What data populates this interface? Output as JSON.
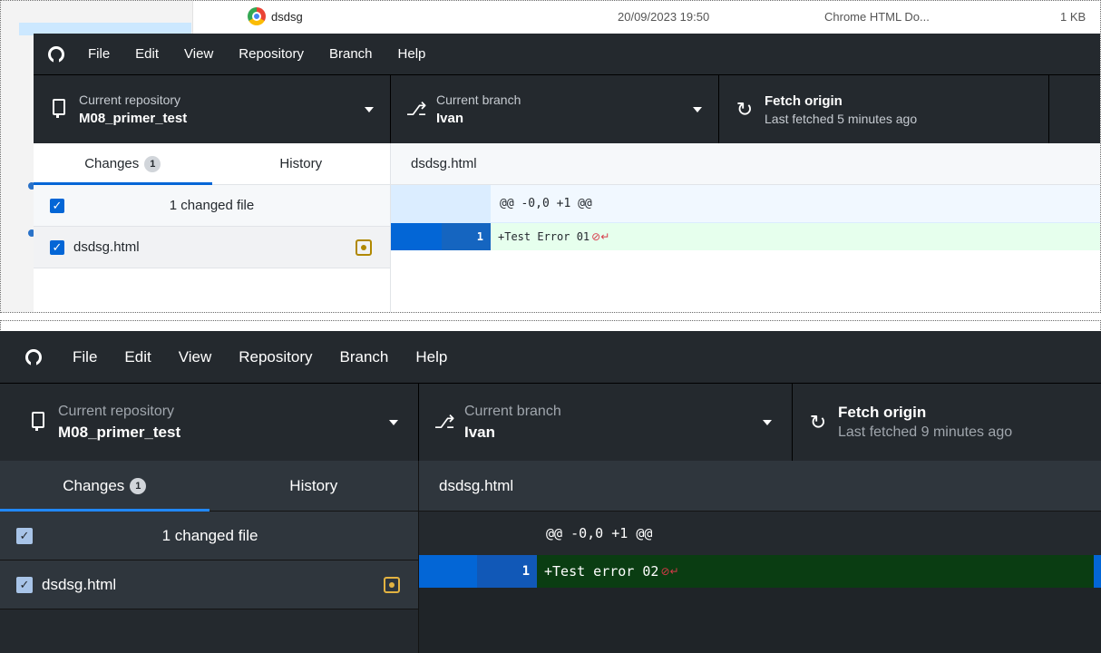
{
  "explorer": {
    "file_name": "dsdsg",
    "file_date": "20/09/2023 19:50",
    "file_type": "Chrome HTML Do...",
    "file_size": "1 KB"
  },
  "top_app": {
    "menu": [
      "File",
      "Edit",
      "View",
      "Repository",
      "Branch",
      "Help"
    ],
    "repo_label": "Current repository",
    "repo_value": "M08_primer_test",
    "branch_label": "Current branch",
    "branch_value": "Ivan",
    "fetch_label": "Fetch origin",
    "fetch_sub": "Last fetched 5 minutes ago",
    "tab_changes": "Changes",
    "tab_changes_count": "1",
    "tab_history": "History",
    "changed_files_label": "1 changed file",
    "file_name": "dsdsg.html",
    "diff_file": "dsdsg.html",
    "hunk_header": "@@ -0,0 +1 @@",
    "line_number": "1",
    "line_text": "+Test Error 01"
  },
  "bottom_app": {
    "menu": [
      "File",
      "Edit",
      "View",
      "Repository",
      "Branch",
      "Help"
    ],
    "repo_label": "Current repository",
    "repo_value": "M08_primer_test",
    "branch_label": "Current branch",
    "branch_value": "Ivan",
    "fetch_label": "Fetch origin",
    "fetch_sub": "Last fetched 9 minutes ago",
    "tab_changes": "Changes",
    "tab_changes_count": "1",
    "tab_history": "History",
    "changed_files_label": "1 changed file",
    "file_name": "dsdsg.html",
    "diff_file": "dsdsg.html",
    "hunk_header": "@@ -0,0 +1 @@",
    "line_number": "1",
    "line_text": "+Test error 02"
  },
  "icons": {
    "app_logo": "github-icon",
    "repo": "repo-icon",
    "branch": "git-branch-icon",
    "fetch": "sync-icon",
    "file_status": "file-modified-icon",
    "no_newline": "no-newline-icon"
  },
  "colors": {
    "accent": "#0366d6",
    "modified": "#b08800",
    "added_light": "#e6ffed",
    "added_dark": "#0a3d12",
    "toolbar": "#24292e",
    "no_newline": "#d73a49"
  }
}
